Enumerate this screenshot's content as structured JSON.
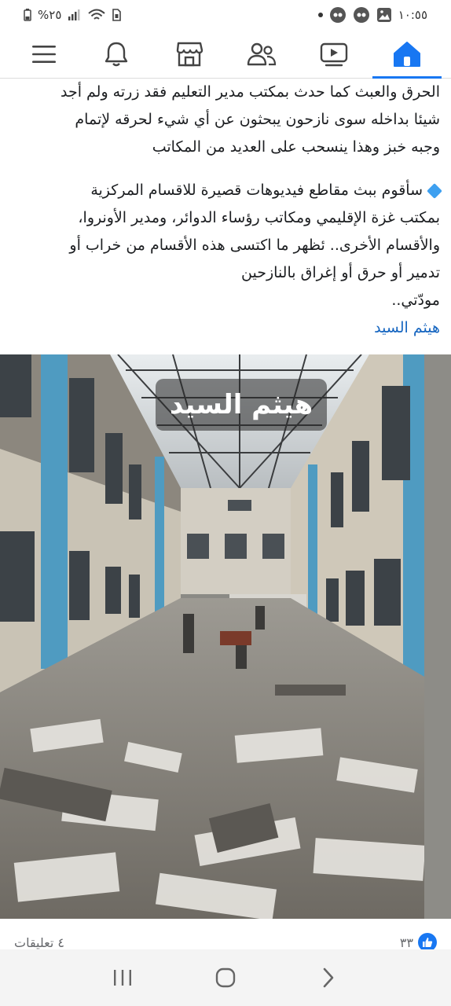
{
  "status_bar": {
    "battery": "%٢٥",
    "time": "١٠:٥٥"
  },
  "nav": {
    "items": [
      {
        "name": "menu-icon"
      },
      {
        "name": "bell-icon"
      },
      {
        "name": "marketplace-icon"
      },
      {
        "name": "friends-icon"
      },
      {
        "name": "video-icon"
      },
      {
        "name": "home-icon",
        "active": true
      }
    ]
  },
  "post": {
    "line1": "الحرق والعبث كما حدث بمكتب مدير التعليم فقد زرته ولم أجد",
    "line2": "شيئا بداخله سوى نازحون يبحثون عن أي شيء لحرقه لإتمام",
    "line3": "وجبه خبز وهذا ينسحب على العديد من المكاتب",
    "line4": "سأقوم ببث مقاطع فيديوهات قصيرة للاقسام المركزية",
    "line5": "بمكتب غزة الإقليمي ومكاتب رؤساء الدوائر، ومدير الأونروا،",
    "line6": "والأقسام الأخرى.. ئظهر ما اكتسى هذه الأقسام من خراب أو",
    "line7": "تدمير أو حرق أو إغراق بالنازحين",
    "line8": "مودّتي..",
    "author": "هيثم السيد"
  },
  "photo": {
    "watermark": "هيثم السيد"
  },
  "reactions": {
    "likes": "٣٣",
    "comments": "٤ تعليقات"
  }
}
